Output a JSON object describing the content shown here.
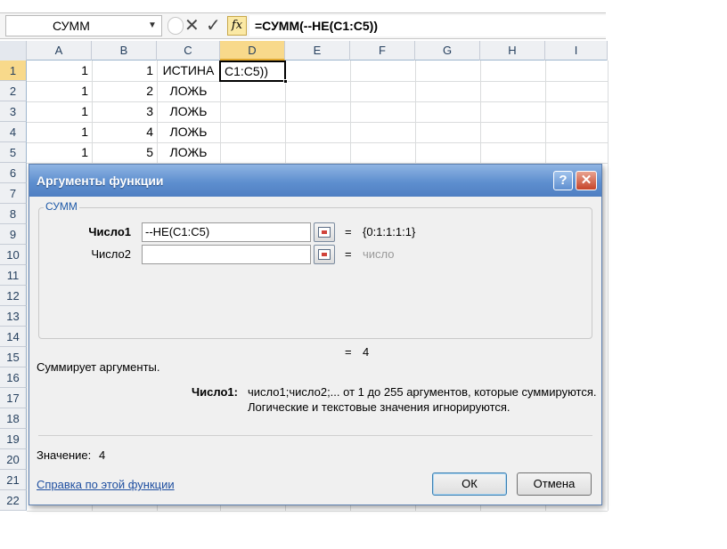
{
  "formula_bar": {
    "name_box": "СУММ",
    "cancel_icon": "✕",
    "enter_icon": "✓",
    "fx_label": "fx",
    "formula": "=СУММ(--НЕ(C1:C5))"
  },
  "grid": {
    "columns": [
      "A",
      "B",
      "C",
      "D",
      "E",
      "F",
      "G",
      "H",
      "I"
    ],
    "rows": [
      "1",
      "2",
      "3",
      "4",
      "5",
      "6",
      "7",
      "8",
      "9",
      "10",
      "11",
      "12",
      "13",
      "14",
      "15",
      "16",
      "17",
      "18",
      "19",
      "20",
      "21",
      "22"
    ],
    "cells": [
      {
        "a": "1",
        "b": "1",
        "c": "ИСТИНА"
      },
      {
        "a": "1",
        "b": "2",
        "c": "ЛОЖЬ"
      },
      {
        "a": "1",
        "b": "3",
        "c": "ЛОЖЬ"
      },
      {
        "a": "1",
        "b": "4",
        "c": "ЛОЖЬ"
      },
      {
        "a": "1",
        "b": "5",
        "c": "ЛОЖЬ"
      }
    ],
    "active_cell_text": "C1:C5))"
  },
  "dialog": {
    "title": "Аргументы функции",
    "help_label": "?",
    "close_label": "✕",
    "function_name": "СУММ",
    "args": [
      {
        "label": "Число1",
        "value": "--НЕ(C1:C5)",
        "eq": "=",
        "result": "{0:1:1:1:1}"
      },
      {
        "label": "Число2",
        "value": "",
        "eq": "=",
        "result": "число"
      }
    ],
    "formula_result_eq": "=",
    "formula_result": "4",
    "description": "Суммирует аргументы.",
    "arg_help_label": "Число1:",
    "arg_help_line1": "число1;число2;... от 1 до 255 аргументов, которые суммируются.",
    "arg_help_line2": "Логические и текстовые значения игнорируются.",
    "value_label": "Значение:",
    "value": "4",
    "help_link": "Справка по этой функции",
    "ok_label": "ОК",
    "cancel_label": "Отмена"
  },
  "colors": {
    "title_bar": "#5e8fcf",
    "selected_header": "#f8d98b",
    "link": "#1f4fa0"
  }
}
